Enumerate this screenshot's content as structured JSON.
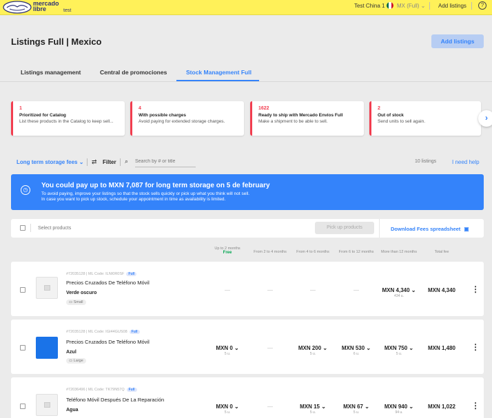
{
  "topbar": {
    "logo_line1": "mercado",
    "logo_line2": "libre",
    "logo_sub": "test",
    "user": "Test China 1",
    "market": "MX (Full) ⌄",
    "add_listings": "Add listings",
    "help": "?",
    "colors": {
      "bar": "#fff159",
      "logo": "#2d3277"
    }
  },
  "header": {
    "title": "Listings Full | Mexico",
    "add_button": "Add listings",
    "tabs": [
      {
        "label": "Listings management",
        "active": false
      },
      {
        "label": "Central de promociones",
        "active": false
      },
      {
        "label": "Stock Management Full",
        "active": true
      }
    ]
  },
  "cards": [
    {
      "count": "1",
      "title": "Prioritized for Catalog",
      "desc": "List these products in the Catalog to keep sell..."
    },
    {
      "count": "4",
      "title": "With possible charges",
      "desc": "Avoid paying for extended storage charges."
    },
    {
      "count": "1622",
      "title": "Ready to ship with Mercado Envíos Full",
      "desc": "Make a shipment to be able to sell."
    },
    {
      "count": "2",
      "title": "Out of stock",
      "desc": "Send units to sell again."
    }
  ],
  "filters": {
    "storage_dropdown": "Long term storage fees ⌄",
    "filter_label": "Filter",
    "search_placeholder": "Search by # or title",
    "count": "10 listings",
    "help": "I need help"
  },
  "banner": {
    "title": "You could pay up to MXN 7,087 for long term storage on 5 de february",
    "line1": "To avoid paying, improve your listings so that the stock sells quickly or pick up what you think will not sell.",
    "line2": "In case you want to pick up stock, schedule your appointment in time as availability is limited.",
    "color": "#3483fa"
  },
  "select_bar": {
    "select_label": "Select products",
    "pickup": "Pick up products",
    "download": "Download Fees spreadsheet"
  },
  "columns": [
    {
      "label": "Up to 2 months",
      "sub": "Free"
    },
    {
      "label": "From 2 to 4 months",
      "sub": ""
    },
    {
      "label": "From 4 to 6 months",
      "sub": ""
    },
    {
      "label": "From 6 to 12 months",
      "sub": ""
    },
    {
      "label": "More than 12 months",
      "sub": ""
    },
    {
      "label": "Total fee",
      "sub": ""
    }
  ],
  "rows": [
    {
      "id": "#72035128 | ML Code: ILNI0R0SF",
      "badge": "Full",
      "name": "Precios Cruzados De Teléfono Móvil",
      "variant": "Verde oscuro",
      "size": "Small",
      "thumb": "placeholder",
      "cells": [
        {
          "v": "—",
          "u": ""
        },
        {
          "v": "—",
          "u": ""
        },
        {
          "v": "—",
          "u": ""
        },
        {
          "v": "—",
          "u": ""
        },
        {
          "v": "MXN 4,340 ⌄",
          "u": "434 u."
        },
        {
          "v": "MXN 4,340",
          "u": ""
        }
      ]
    },
    {
      "id": "#72035128 | ML Code: IGI44GUS08",
      "badge": "Full",
      "name": "Precios Cruzados De Teléfono Móvil",
      "variant": "Azul",
      "size": "Large",
      "thumb": "#1a73e8",
      "cells": [
        {
          "v": "MXN 0 ⌄",
          "u": "5 u."
        },
        {
          "v": "—",
          "u": ""
        },
        {
          "v": "MXN 200 ⌄",
          "u": "5 u."
        },
        {
          "v": "MXN 530 ⌄",
          "u": "6 u."
        },
        {
          "v": "MXN 750 ⌄",
          "u": "5 u."
        },
        {
          "v": "MXN 1,480",
          "u": ""
        }
      ]
    },
    {
      "id": "#72036496 | ML Code: TK79N57Q",
      "badge": "Full",
      "name": "Teléfono Móvil Después De La Reparación",
      "variant": "Agua",
      "size": "",
      "thumb": "placeholder",
      "cells": [
        {
          "v": "MXN 0 ⌄",
          "u": "5 u."
        },
        {
          "v": "—",
          "u": ""
        },
        {
          "v": "MXN 15 ⌄",
          "u": "5 u."
        },
        {
          "v": "MXN 67 ⌄",
          "u": "5 u."
        },
        {
          "v": "MXN 940 ⌄",
          "u": "94 u."
        },
        {
          "v": "MXN 1,022",
          "u": ""
        }
      ]
    }
  ]
}
